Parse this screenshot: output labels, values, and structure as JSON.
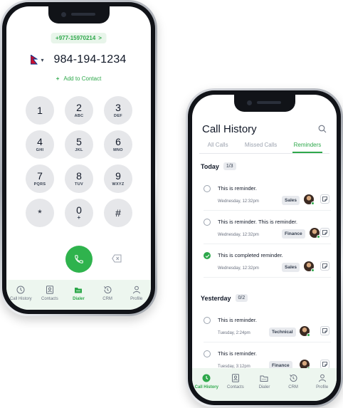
{
  "dialer": {
    "number_chip": "+977-15970214",
    "chip_chevron": ">",
    "dialed_number": "984-194-1234",
    "caret": "▾",
    "add_contact_plus": "+",
    "add_contact_label": "Add to Contact",
    "keys": [
      {
        "digit": "1",
        "letters": ""
      },
      {
        "digit": "2",
        "letters": "ABC"
      },
      {
        "digit": "3",
        "letters": "DEF"
      },
      {
        "digit": "4",
        "letters": "GHI"
      },
      {
        "digit": "5",
        "letters": "JKL"
      },
      {
        "digit": "6",
        "letters": "MNO"
      },
      {
        "digit": "7",
        "letters": "PQRS"
      },
      {
        "digit": "8",
        "letters": "TUV"
      },
      {
        "digit": "9",
        "letters": "WXYZ"
      },
      {
        "digit": "*",
        "letters": ""
      },
      {
        "digit": "0",
        "letters": "+"
      },
      {
        "digit": "#",
        "letters": ""
      }
    ],
    "call_button_color": "#2fb34d"
  },
  "nav1": {
    "tabs": [
      {
        "label": "Call History",
        "icon": "clock-icon"
      },
      {
        "label": "Contacts",
        "icon": "contact-card-icon"
      },
      {
        "label": "Dialer",
        "icon": "dialpad-icon"
      },
      {
        "label": "CRM",
        "icon": "history-icon"
      },
      {
        "label": "Profile",
        "icon": "person-icon"
      }
    ],
    "active": "Dialer"
  },
  "history": {
    "title": "Call History",
    "tabs": [
      "All Calls",
      "Missed Calls",
      "Reminders"
    ],
    "active_tab": "Reminders",
    "today_label": "Today",
    "today_count": "1/3",
    "yesterday_label": "Yesterday",
    "yesterday_count": "0/2",
    "reminders": [
      {
        "text": "This is reminder.",
        "date": "Wednesday, 12:32pm",
        "tag": "Sales",
        "done": false
      },
      {
        "text": "This is reminder. This is reminder.",
        "date": "Wednesday, 12:32pm",
        "tag": "Finance",
        "done": false
      },
      {
        "text": "This is completed reminder.",
        "date": "Wednesday, 12:32pm",
        "tag": "Sales",
        "done": true
      },
      {
        "text": "This is reminder.",
        "date": "Tuesday, 2:24pm",
        "tag": "Technical",
        "done": false
      },
      {
        "text": "This is reminder.",
        "date": "Tuesday, 3:12pm",
        "tag": "Finance",
        "done": false
      }
    ]
  },
  "nav2": {
    "tabs": [
      {
        "label": "Call History",
        "icon": "clock-icon"
      },
      {
        "label": "Contacts",
        "icon": "contact-card-icon"
      },
      {
        "label": "Dialer",
        "icon": "dialpad-icon"
      },
      {
        "label": "CRM",
        "icon": "history-icon"
      },
      {
        "label": "Profile",
        "icon": "person-icon"
      }
    ],
    "active": "Call History"
  },
  "colors": {
    "accent": "#2ea84b",
    "tabbar_bg": "#edf6ef",
    "key_bg": "#e6e7ea"
  }
}
